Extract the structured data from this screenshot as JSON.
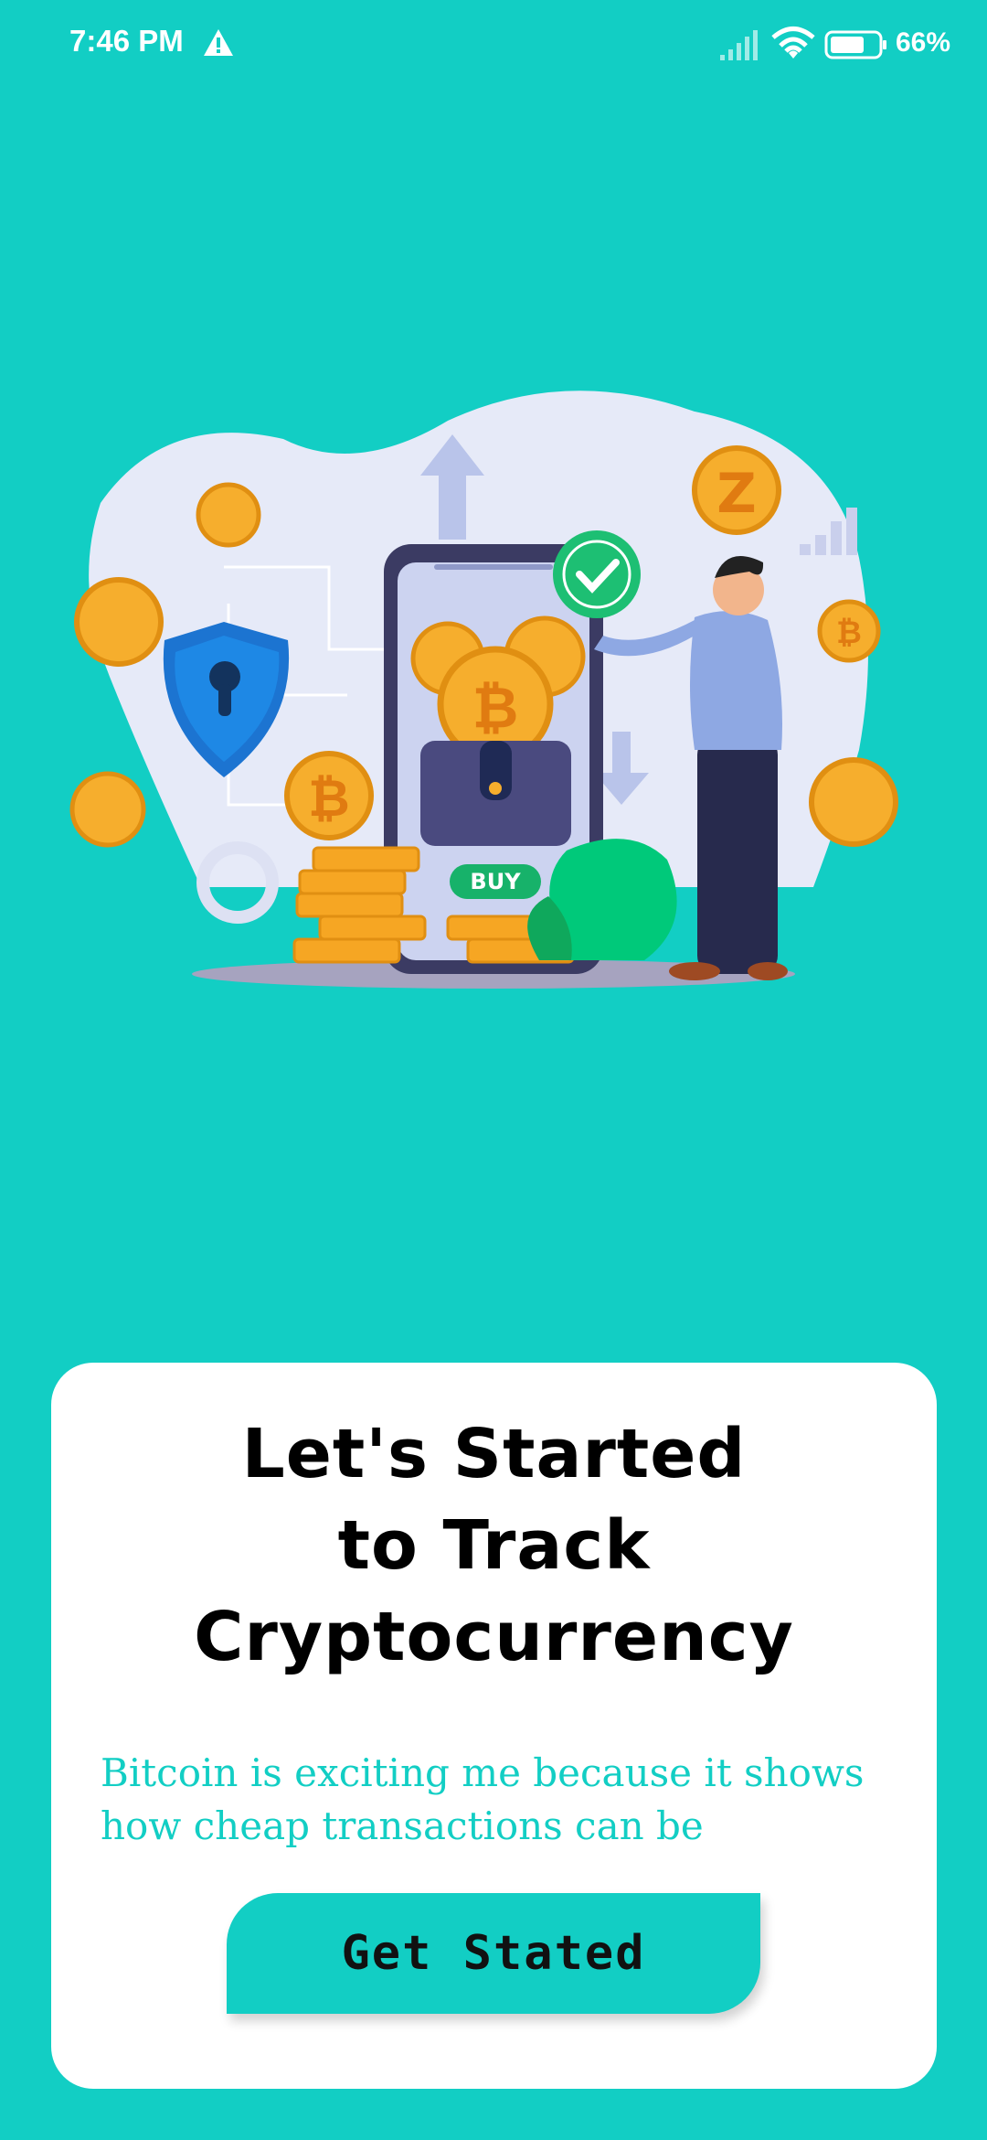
{
  "status_bar": {
    "time": "7:46 PM",
    "battery": "66%",
    "icons": [
      "warning-icon",
      "signal-icon",
      "wifi-icon",
      "battery-icon"
    ]
  },
  "illustration": {
    "buy_label": "BUY"
  },
  "card": {
    "headline": [
      "Let's Started",
      "to Track",
      "Cryptocurrency"
    ],
    "subtitle": "Bitcoin is exciting me because it shows how cheap transactions can be",
    "button_label": "Get Stated"
  },
  "colors": {
    "background": "#12cec4",
    "accent": "#12cec4",
    "card": "#ffffff",
    "coin": "#f6ae2d"
  }
}
